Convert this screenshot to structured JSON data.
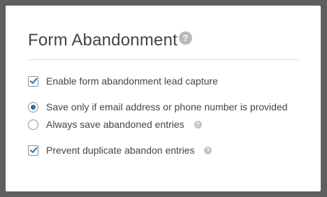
{
  "panel": {
    "title": "Form Abandonment",
    "title_help_glyph": "?"
  },
  "options": {
    "enable_capture": {
      "label": "Enable form abandonment lead capture",
      "checked": true
    },
    "save_mode": {
      "selected": "email_or_phone",
      "choices": [
        {
          "label": "Save only if email address or phone number is provided",
          "selected": true
        },
        {
          "label": "Always save abandoned entries",
          "selected": false,
          "help_glyph": "?"
        }
      ]
    },
    "prevent_duplicates": {
      "label": "Prevent duplicate abandon entries",
      "checked": true,
      "help_glyph": "?"
    }
  },
  "colors": {
    "accent": "#2271b1",
    "backdrop": "#5f5f5f",
    "text": "#444444",
    "help_icon": "#bbbbbb"
  },
  "icons": [
    "help-icon",
    "checkmark-icon",
    "radio-dot-icon"
  ]
}
